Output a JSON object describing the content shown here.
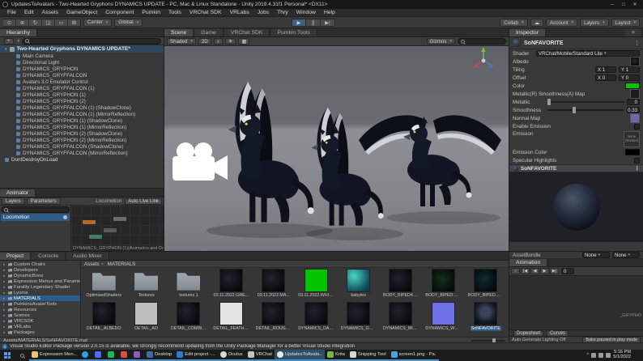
{
  "icons": {
    "dd": "▾",
    "tri": "▸",
    "tri_open": "▾",
    "close": "✕",
    "min": "─",
    "max": "□",
    "menu": "≡",
    "more": "⋮",
    "plus": "+",
    "play": "▶",
    "pause": "∥",
    "step": "▶|",
    "record": "●",
    "first": "|◀",
    "prev": "◀",
    "next": "▶",
    "last": "▶|",
    "cloud": "☁",
    "i": "i",
    "chev_up": "^"
  },
  "titlebar": {
    "title": "UpdatesToAvatars - Two-Hearted Gryphons DYNAMICS UPDATE - PC, Mac & Linux Standalone - Unity 2019.4.31f1 Personal* <DX11>"
  },
  "menubar": {
    "items": [
      "File",
      "Edit",
      "Assets",
      "GameObject",
      "Component",
      "Pumkin",
      "Tools",
      "VRChat SDK",
      "VRLabs",
      "Jobs",
      "Thry",
      "Window",
      "Help"
    ]
  },
  "toolbar": {
    "tools": [
      "⊙",
      "⊕",
      "↻",
      "◲",
      "▭",
      "⊞"
    ],
    "pivot": "Center",
    "space": "Global",
    "collab": "Collab",
    "account": "Account",
    "layers": "Layers",
    "layout": "Layout"
  },
  "hierarchy": {
    "tab": "Hierarchy",
    "scene_root": "Two-Hearted Gryphons DYNAMICS UPDATE*",
    "items": [
      {
        "label": "Main Camera"
      },
      {
        "label": "Directional Light"
      },
      {
        "label": "DYNAMICS_GRYPHON"
      },
      {
        "label": "DYNAMICS_GRYFFALCON"
      },
      {
        "label": "Avatars 3.0 Emulator Control"
      },
      {
        "label": "DYNAMICS_GRYFFALCON (1)"
      },
      {
        "label": "DYNAMICS_GRYPHON (1)"
      },
      {
        "label": "DYNAMICS_GRYPHON (2)"
      },
      {
        "label": "DYNAMICS_GRYFFALCON (1) (ShadowClone)"
      },
      {
        "label": "DYNAMICS_GRYFFALCON (1) (MirrorReflection)"
      },
      {
        "label": "DYNAMICS_GRYPHON (1) (ShadowClone)"
      },
      {
        "label": "DYNAMICS_GRYPHON (1) (MirrorReflection)"
      },
      {
        "label": "DYNAMICS_GRYPHON (2) (ShadowClone)"
      },
      {
        "label": "DYNAMICS_GRYPHON (2) (MirrorReflection)"
      },
      {
        "label": "DYNAMICS_GRYFFALCON (ShadowClone)"
      },
      {
        "label": "DYNAMICS_GRYFFALCON (MirrorReflection)"
      },
      {
        "label": "DontDestroyOnLoad",
        "cls": "rootrow"
      }
    ]
  },
  "animator": {
    "tab": "Animator",
    "layers_tab": "Layers",
    "parameters_tab": "Parameters",
    "selected_layer": "Locomotion",
    "right_label": "Locomotion",
    "auto_live_link": "Auto Live Link",
    "status": "DYNAMICS_GRYPHON (1)(Animatics and Dom(MirrorRefle"
  },
  "scene": {
    "tabs": [
      {
        "label": "Scene",
        "cls": "active"
      },
      {
        "label": "Game"
      },
      {
        "label": "VRChat SDK"
      },
      {
        "label": "Pumkin Tools"
      }
    ],
    "shaded": "Shaded",
    "mode_2d": "2D",
    "sound": "♪",
    "lighting": "☀",
    "overlay": "▦",
    "gizmos": "Gizmos"
  },
  "inspector": {
    "tab": "Inspector",
    "material_name": "SoNFAVORITE",
    "shader_label": "Shader",
    "shader_value": "VRChat/Mobile/Standard Lite",
    "albedo": "Albedo",
    "tiling_label": "Tiling",
    "tiling_x": "X 1",
    "tiling_y": "Y 1",
    "offset_label": "Offset",
    "offset_x": "X 0",
    "offset_y": "Y 0",
    "color_label": "Color",
    "color_value": "#04c404",
    "metallic_map_label": "Metallic(R) Smoothness(A) Map",
    "metallic_label": "Metallic",
    "metallic_value": "0",
    "smoothness_label": "Smoothness",
    "smoothness_value": "0.33",
    "normal_map_label": "Normal Map",
    "enable_emission_label": "Enable Emission",
    "emission_label": "Emission",
    "none_texture": "None (Texture)",
    "emission_color_label": "Emission Color",
    "specular_label": "Specular Highlights",
    "preview_title": "SoNFAVORITE"
  },
  "assetbundle": {
    "label": "AssetBundle",
    "bundle": "None",
    "variant": "None"
  },
  "animation": {
    "tab": "Animation",
    "frame": "0",
    "clip_hint": "_GRYPHO",
    "dopesheet": "Dopesheet",
    "curves": "Curves"
  },
  "lighting": {
    "auto_generate": "Auto Generate Lighting Off",
    "bake_button": "Bake paused in play mode"
  },
  "project": {
    "tabs": [
      {
        "label": "Project",
        "cls": "active"
      },
      {
        "label": "Console"
      },
      {
        "label": "Audio Mixer"
      }
    ],
    "folders": [
      {
        "label": "Custom Chairs"
      },
      {
        "label": "Developers"
      },
      {
        "label": "DynamicBone"
      },
      {
        "label": "Expression Menus and Parame"
      },
      {
        "label": "Furality Legendary Shader"
      },
      {
        "label": "Lyuma"
      },
      {
        "label": "MATERIALS",
        "cls": "sel"
      },
      {
        "label": "PumkinsAvatarTools"
      },
      {
        "label": "Resources"
      },
      {
        "label": "Scenes"
      },
      {
        "label": "VRCSDK"
      },
      {
        "label": "VRLabs"
      },
      {
        "label": "Packages"
      }
    ],
    "breadcrumb_root": "Assets",
    "breadcrumb_current": "MATERIALS",
    "items": [
      {
        "label": "OptimisedShaders",
        "type": "folder"
      },
      {
        "label": "Textures",
        "type": "folder"
      },
      {
        "label": "textures 1",
        "type": "folder"
      },
      {
        "label": "03.11.2022.GRE...",
        "type": "dark"
      },
      {
        "label": "03.11.2022.MA...",
        "type": "dark"
      },
      {
        "label": "03.11.2022.WHITE",
        "type": "green"
      },
      {
        "label": "babytex",
        "type": "teal"
      },
      {
        "label": "BODY_BIPED4.C...",
        "type": "dark"
      },
      {
        "label": "BODY_BIPED.GR...",
        "type": "darkgreen"
      },
      {
        "label": "BODY_BIPED.WH...",
        "type": "darkteal"
      },
      {
        "label": "DETAIL_ALBEDO",
        "type": "dark"
      },
      {
        "label": "DETAIL_AO",
        "type": "gray"
      },
      {
        "label": "DETAIL_COMBIN...",
        "type": "dark"
      },
      {
        "label": "DETAIL_FEATHERS",
        "type": "white"
      },
      {
        "label": "DETAIL_ROUGHN...",
        "type": "dark"
      },
      {
        "label": "DYNAMICS_DARK",
        "type": "dark"
      },
      {
        "label": "DYNAMICS_GRE...",
        "type": "dark"
      },
      {
        "label": "DYNAMICS_MIRR...",
        "type": "dark"
      },
      {
        "label": "DYNAMICS_WHI...",
        "type": "purple"
      },
      {
        "label": "SoNFAVORITE",
        "type": "gryphon",
        "cls": "sel"
      }
    ],
    "selected_path": "Assets/MATERIALS/SoNFAVORITE.mat"
  },
  "statusbar": {
    "message": "Visual Studio Editor Package version 2.0.15 is available, we strongly recommend updating from the Unity Package Manager for a better Visual Studio integration"
  },
  "taskbar": {
    "items": [
      {
        "label": "Expression Men...",
        "icon": "ic-folder"
      },
      {
        "label": "",
        "icon": "ic-telegram"
      },
      {
        "label": "",
        "icon": "ic-app1"
      },
      {
        "label": "",
        "icon": "ic-app2"
      },
      {
        "label": "",
        "icon": "ic-app3"
      },
      {
        "label": "",
        "icon": "ic-app4"
      },
      {
        "label": "Desktop",
        "icon": "ic-desktop"
      },
      {
        "label": "Edit project -...",
        "icon": "ic-code"
      },
      {
        "label": "Oculus",
        "icon": "ic-oculus"
      },
      {
        "label": "VRChat",
        "icon": "ic-vrchat"
      },
      {
        "label": "UpdatesToAvata...",
        "icon": "ic-unity",
        "cls": "active"
      },
      {
        "label": "Krita",
        "icon": "ic-krita"
      },
      {
        "label": "Snipping Tool",
        "icon": "ic-snip"
      },
      {
        "label": "screen1.png - Pa...",
        "icon": "ic-paint"
      }
    ],
    "time": "5:16 PM",
    "date": "5/1/2022"
  }
}
